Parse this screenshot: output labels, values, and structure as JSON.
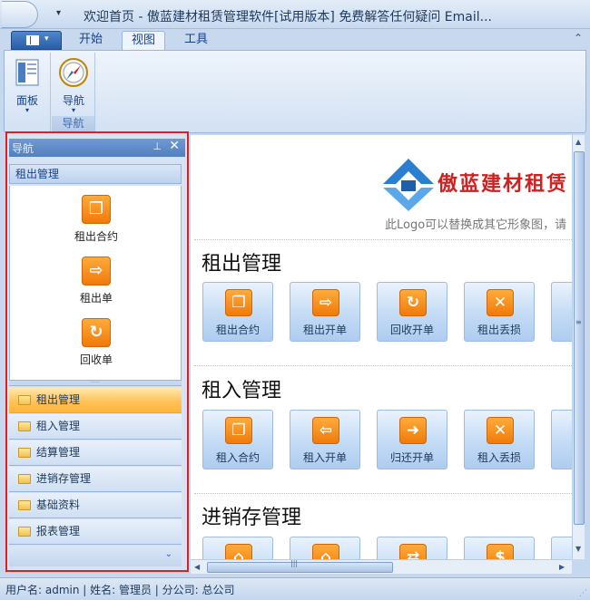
{
  "window": {
    "title": "欢迎首页 - 傲蓝建材租赁管理软件[试用版本] 免费解答任何疑问 Email...",
    "minimize": "—",
    "maximize": "☐",
    "close": "✕"
  },
  "ribbon": {
    "app_button_caret": "▾",
    "qat_arrow": "▾",
    "tabs": [
      {
        "label": "开始",
        "active": false
      },
      {
        "label": "视图",
        "active": true
      },
      {
        "label": "工具",
        "active": false
      }
    ],
    "collapse": "≈",
    "groups": [
      {
        "caption": "",
        "buttons": [
          {
            "label": "面板",
            "icon": "panel-icon",
            "dropdown": "▾"
          }
        ]
      },
      {
        "caption": "导航",
        "buttons": [
          {
            "label": "导航",
            "icon": "compass-icon",
            "dropdown": "▾"
          }
        ]
      }
    ]
  },
  "nav": {
    "header": "导航",
    "pin": "⊥",
    "close": "✕",
    "group_title": "租出管理",
    "items": [
      {
        "label": "租出合约",
        "icon": "contract-icon",
        "glyph": "❐"
      },
      {
        "label": "租出单",
        "icon": "export-doc-icon",
        "glyph": "⇨"
      },
      {
        "label": "回收单",
        "icon": "refresh-icon",
        "glyph": "↻"
      }
    ],
    "scroll_down": "▼",
    "splitter": "·····",
    "buttons": [
      {
        "label": "租出管理",
        "active": true
      },
      {
        "label": "租入管理",
        "active": false
      },
      {
        "label": "结算管理",
        "active": false
      },
      {
        "label": "进销存管理",
        "active": false
      },
      {
        "label": "基础资料",
        "active": false
      },
      {
        "label": "报表管理",
        "active": false
      }
    ],
    "footer_chevron": "⌄"
  },
  "main": {
    "logo_text": "傲蓝建材租赁",
    "logo_subtitle": "此Logo可以替换成其它形象图，请",
    "sections": [
      {
        "title": "租出管理",
        "tiles": [
          {
            "label": "租出合约",
            "icon": "contract-icon",
            "glyph": "❐"
          },
          {
            "label": "租出开单",
            "icon": "export-doc-icon",
            "glyph": "⇨"
          },
          {
            "label": "回收开单",
            "icon": "refresh-icon",
            "glyph": "↻"
          },
          {
            "label": "租出丢损",
            "icon": "loss-icon",
            "glyph": "✕"
          },
          {
            "label": "租",
            "icon": "doc-icon",
            "glyph": "❐"
          }
        ]
      },
      {
        "title": "租入管理",
        "tiles": [
          {
            "label": "租入合约",
            "icon": "contract-icon",
            "glyph": "❐"
          },
          {
            "label": "租入开单",
            "icon": "import-doc-icon",
            "glyph": "⇦"
          },
          {
            "label": "归还开单",
            "icon": "return-icon",
            "glyph": "➜"
          },
          {
            "label": "租入丢损",
            "icon": "loss-icon",
            "glyph": "✕"
          },
          {
            "label": "租",
            "icon": "doc-icon",
            "glyph": "❐"
          }
        ]
      },
      {
        "title": "进销存管理",
        "tiles": [
          {
            "label": "",
            "icon": "warehouse-in-icon",
            "glyph": "⌂"
          },
          {
            "label": "",
            "icon": "warehouse-out-icon",
            "glyph": "⌂"
          },
          {
            "label": "",
            "icon": "transfer-icon",
            "glyph": "⇄"
          },
          {
            "label": "",
            "icon": "invoice-icon",
            "glyph": "$"
          },
          {
            "label": "",
            "icon": "doc-icon",
            "glyph": "❐"
          }
        ]
      }
    ]
  },
  "scroll": {
    "up": "▲",
    "down": "▼",
    "left": "◀",
    "right": "▶",
    "grip_v": "≡",
    "grip_h": "|||"
  },
  "status": {
    "text": "用户名: admin  | 姓名: 管理员  | 分公司: 总公司",
    "resize": "⋰"
  }
}
